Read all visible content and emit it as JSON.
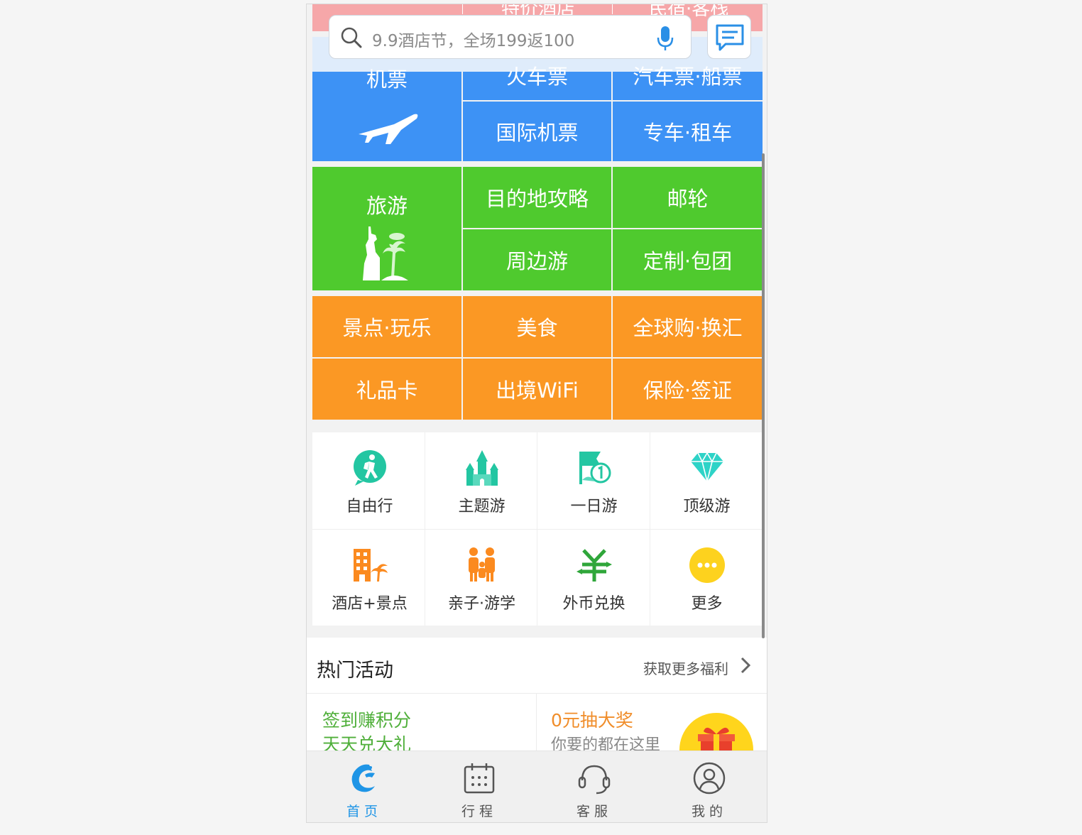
{
  "top_strip": {
    "ghost_labels": [
      "",
      "特价酒店",
      "民宿·客栈"
    ]
  },
  "search": {
    "placeholder": "9.9酒店节，全场199返100",
    "icon": "search-icon",
    "mic_icon": "microphone-icon"
  },
  "message_icon": "message-icon",
  "services": {
    "flight": "机票",
    "train": "火车票",
    "bus_ship": "汽车票·船票",
    "intl_flight": "国际机票",
    "car_rental": "专车·租车",
    "travel": "旅游",
    "guide": "目的地攻略",
    "cruise": "邮轮",
    "nearby": "周边游",
    "custom": "定制·包团",
    "attractions": "景点·玩乐",
    "food": "美食",
    "global_buy": "全球购·换汇",
    "gift_card": "礼品卡",
    "wifi": "出境WiFi",
    "insurance_visa": "保险·签证"
  },
  "categories": [
    {
      "label": "自由行",
      "icon": "hiker-icon"
    },
    {
      "label": "主题游",
      "icon": "castle-icon"
    },
    {
      "label": "一日游",
      "icon": "one-day-flag-icon"
    },
    {
      "label": "顶级游",
      "icon": "diamond-icon"
    },
    {
      "label": "酒店+景点",
      "icon": "hotel-palm-icon"
    },
    {
      "label": "亲子·游学",
      "icon": "family-icon"
    },
    {
      "label": "外币兑换",
      "icon": "currency-exchange-icon"
    },
    {
      "label": "更多",
      "icon": "more-icon"
    }
  ],
  "hot": {
    "title": "热门活动",
    "more": "获取更多福利",
    "promo1_line1": "签到赚积分",
    "promo1_line2": "天天兑大礼",
    "promo2_line1": "0元抽大奖",
    "promo2_line2": "你要的都在这里"
  },
  "tabs": [
    {
      "label": "首页",
      "icon": "dolphin-home-icon",
      "active": true
    },
    {
      "label": "行程",
      "icon": "calendar-icon",
      "active": false
    },
    {
      "label": "客服",
      "icon": "headset-icon",
      "active": false
    },
    {
      "label": "我的",
      "icon": "user-icon",
      "active": false
    }
  ],
  "colors": {
    "blue": "#3d92f5",
    "green": "#4fca2e",
    "orange": "#fb9824",
    "accent": "#1f95e6"
  }
}
